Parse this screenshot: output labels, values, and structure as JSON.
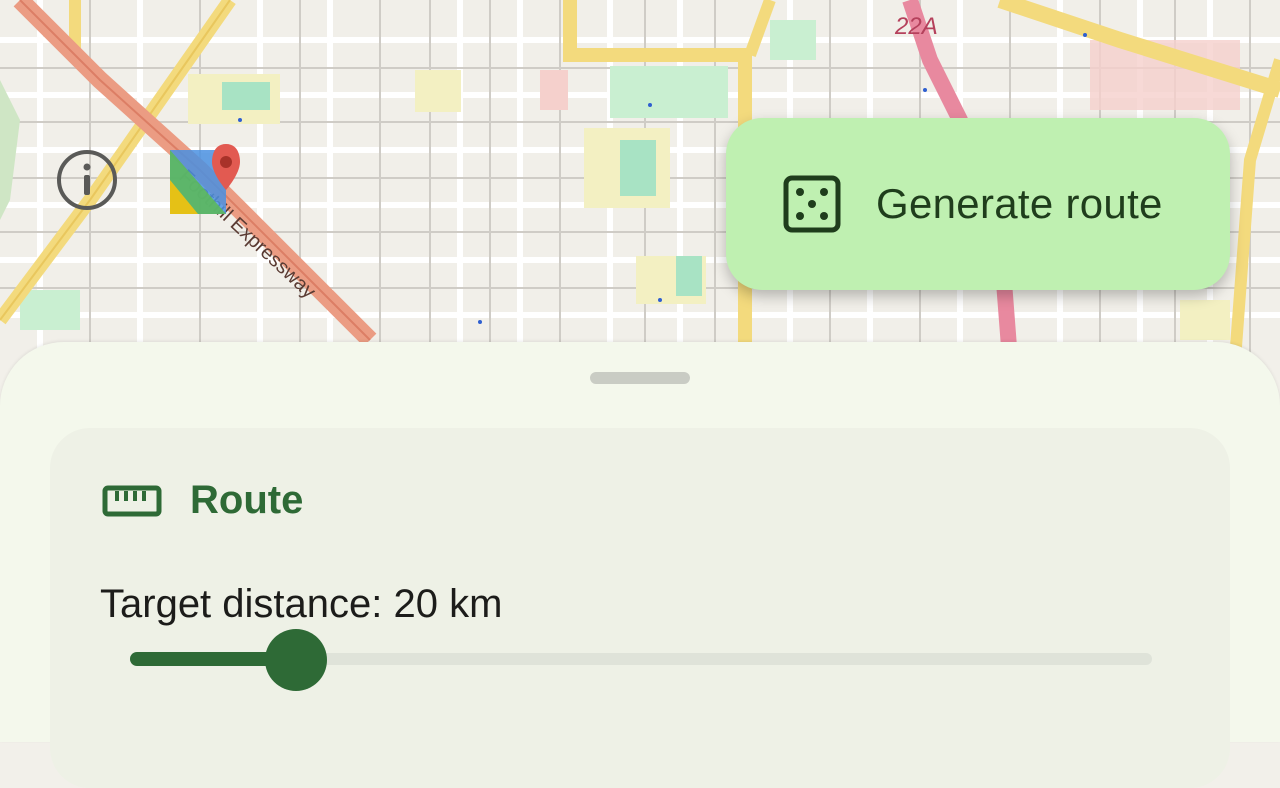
{
  "map": {
    "road_labels": [
      "Foothill Expressway",
      "22A"
    ]
  },
  "map_controls": {
    "info_icon": "info-circle-icon",
    "maps_icon": "google-maps-icon"
  },
  "generate_button": {
    "label": "Generate route",
    "icon": "dice-five-icon"
  },
  "route_card": {
    "title": "Route",
    "icon": "ruler-icon",
    "distance_label": "Target distance: 20 km",
    "distance_fraction": 0.162
  },
  "colors": {
    "primary": "#2e6a36",
    "button_bg": "#bff0b1",
    "sheet_bg": "#f4f8ec",
    "card_bg": "#eef1e6"
  }
}
